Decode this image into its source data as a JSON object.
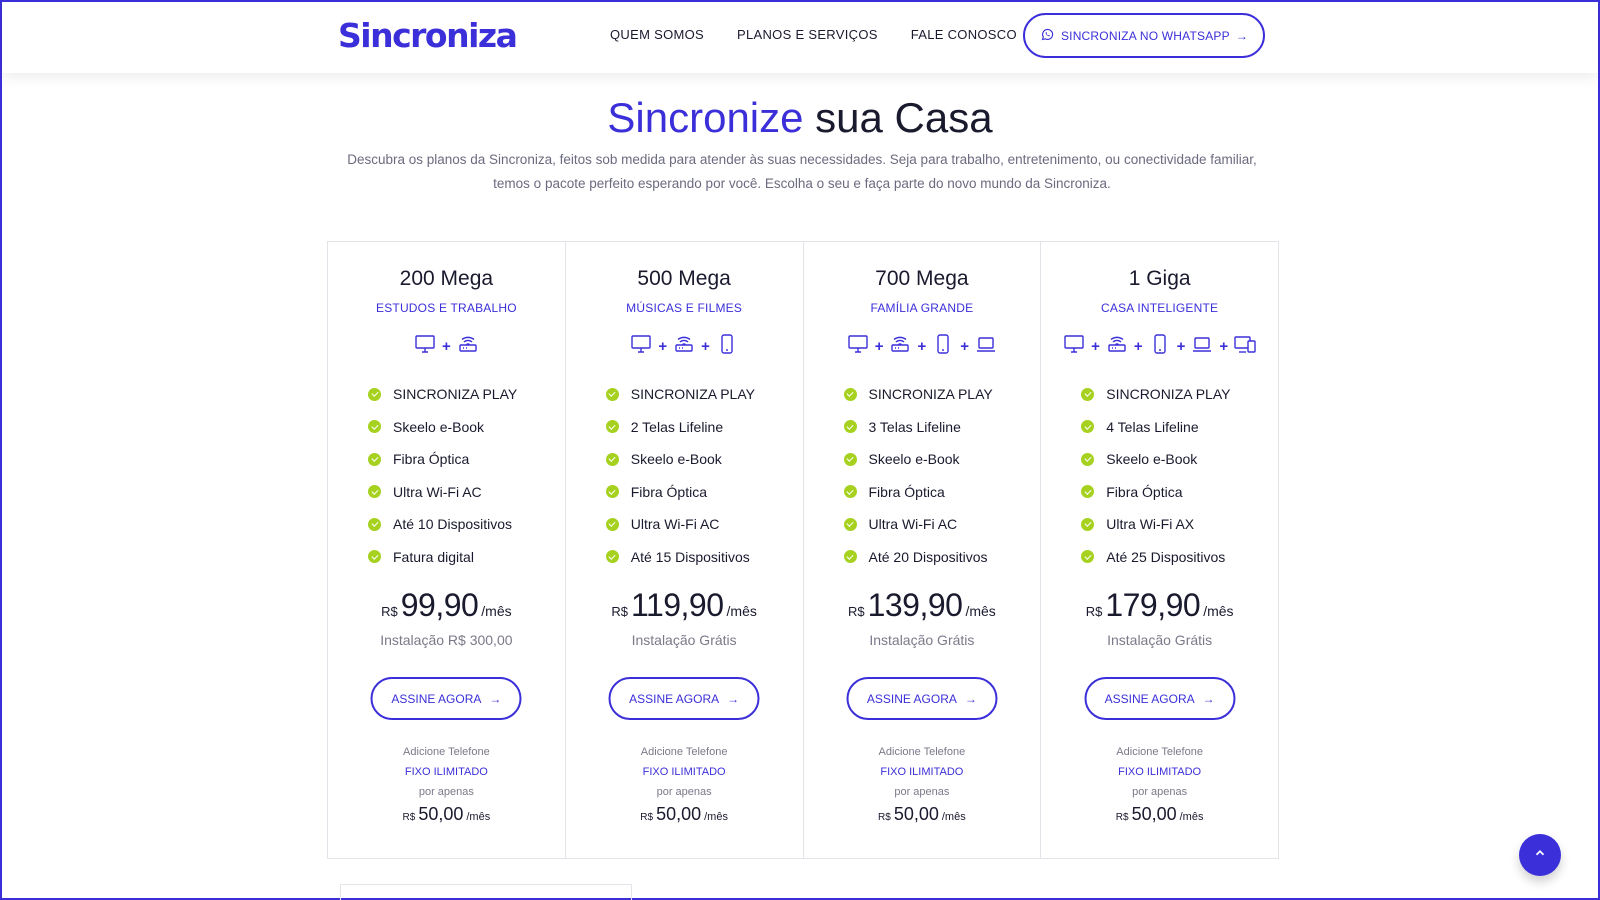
{
  "header": {
    "logo": "Sincroniza",
    "nav": [
      "QUEM SOMOS",
      "PLANOS E SERVIÇOS",
      "FALE CONOSCO"
    ],
    "whatsapp_label": "SINCRONIZA NO WHATSAPP",
    "arrow": "→"
  },
  "hero": {
    "title_accent": "Sincronize",
    "title_rest": " sua Casa",
    "subtitle_line1": "Descubra os planos da Sincroniza, feitos sob medida para atender às suas necessidades. Seja para trabalho, entretenimento, ou conectividade familiar,",
    "subtitle_line2": "temos o pacote perfeito esperando por você. Escolha o seu e faça parte do novo mundo da Sincroniza."
  },
  "colors": {
    "accent": "#3b2fd9",
    "check": "#a6d11f"
  },
  "plans": [
    {
      "name": "200 Mega",
      "tag": "ESTUDOS E TRABALHO",
      "icons": [
        "desktop-icon",
        "router-icon"
      ],
      "features": [
        "SINCRONIZA PLAY",
        "Skeelo e-Book",
        "Fibra Óptica",
        "Ultra Wi-Fi AC",
        "Até 10 Dispositivos",
        "Fatura digital"
      ],
      "currency": "R$",
      "price": "99,90",
      "per": "/mês",
      "install": "Instalação R$ 300,00",
      "cta": "ASSINE AGORA"
    },
    {
      "name": "500 Mega",
      "tag": "MÚSICAS E FILMES",
      "icons": [
        "desktop-icon",
        "router-icon",
        "phone-icon"
      ],
      "features": [
        "SINCRONIZA PLAY",
        "2 Telas Lifeline",
        "Skeelo e-Book",
        "Fibra Óptica",
        "Ultra Wi-Fi AC",
        "Até 15 Dispositivos"
      ],
      "currency": "R$",
      "price": "119,90",
      "per": "/mês",
      "install": "Instalação Grátis",
      "cta": "ASSINE AGORA"
    },
    {
      "name": "700 Mega",
      "tag": "FAMÍLIA GRANDE",
      "icons": [
        "desktop-icon",
        "router-icon",
        "phone-icon",
        "laptop-icon"
      ],
      "features": [
        "SINCRONIZA PLAY",
        "3 Telas Lifeline",
        "Skeelo e-Book",
        "Fibra Óptica",
        "Ultra Wi-Fi AC",
        "Até 20 Dispositivos"
      ],
      "currency": "R$",
      "price": "139,90",
      "per": "/mês",
      "install": "Instalação Grátis",
      "cta": "ASSINE AGORA"
    },
    {
      "name": "1 Giga",
      "tag": "CASA INTELIGENTE",
      "icons": [
        "desktop-icon",
        "router-icon",
        "phone-icon",
        "laptop-icon",
        "devices-icon"
      ],
      "features": [
        "SINCRONIZA PLAY",
        "4 Telas Lifeline",
        "Skeelo e-Book",
        "Fibra Óptica",
        "Ultra Wi-Fi AX",
        "Até 25 Dispositivos"
      ],
      "currency": "R$",
      "price": "179,90",
      "per": "/mês",
      "install": "Instalação Grátis",
      "cta": "ASSINE AGORA"
    }
  ],
  "addon": {
    "line1": "Adicione Telefone",
    "line2": "FIXO ILIMITADO",
    "line3": "por apenas",
    "currency": "R$",
    "price": "50,00",
    "per": "/mês"
  },
  "icons": {
    "whatsapp": "whatsapp-icon",
    "scroll_top": "chevron-up-icon"
  }
}
